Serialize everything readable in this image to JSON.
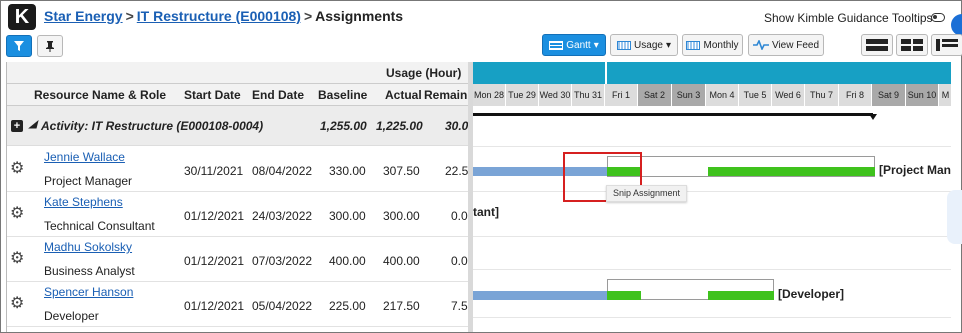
{
  "header": {
    "logo_letter": "K",
    "breadcrumb": [
      {
        "label": "Star Energy"
      },
      {
        "label": "IT Restructure (E000108)"
      },
      {
        "label": "Assignments"
      }
    ],
    "separator": ">",
    "guidance_label": "Show Kimble Guidance Tooltips"
  },
  "toolbar": {
    "gantt_label": "Gantt",
    "usage_label": "Usage",
    "monthly_label": "Monthly",
    "view_feed_label": "View Feed"
  },
  "table": {
    "group_header": "Usage (Hour)",
    "columns": [
      "Resource Name & Role",
      "Start Date",
      "End Date",
      "Baseline",
      "Actual",
      "Remaining"
    ],
    "activity": {
      "label": "Activity: IT Restructure (E000108-0004)",
      "baseline": "1,255.00",
      "actual": "1,225.00",
      "remaining": "30.0"
    },
    "rows": [
      {
        "name": "Jennie Wallace",
        "role": "Project Manager",
        "start": "30/11/2021",
        "end": "08/04/2022",
        "baseline": "330.00",
        "actual": "307.50",
        "remaining": "22.5"
      },
      {
        "name": "Kate Stephens",
        "role": "Technical Consultant",
        "start": "01/12/2021",
        "end": "24/03/2022",
        "baseline": "300.00",
        "actual": "300.00",
        "remaining": "0.0"
      },
      {
        "name": "Madhu Sokolsky",
        "role": "Business Analyst",
        "start": "01/12/2021",
        "end": "07/03/2022",
        "baseline": "400.00",
        "actual": "400.00",
        "remaining": "0.0"
      },
      {
        "name": "Spencer Hanson",
        "role": "Developer",
        "start": "01/12/2021",
        "end": "05/04/2022",
        "baseline": "225.00",
        "actual": "217.50",
        "remaining": "7.5"
      }
    ]
  },
  "gantt": {
    "days": [
      {
        "label": "Mon 28",
        "weekend": false
      },
      {
        "label": "Tue 29",
        "weekend": false
      },
      {
        "label": "Wed 30",
        "weekend": false
      },
      {
        "label": "Thu 31",
        "weekend": false
      },
      {
        "label": "Fri 1",
        "weekend": false
      },
      {
        "label": "Sat 2",
        "weekend": true
      },
      {
        "label": "Sun 3",
        "weekend": true
      },
      {
        "label": "Mon 4",
        "weekend": false
      },
      {
        "label": "Tue 5",
        "weekend": false
      },
      {
        "label": "Wed 6",
        "weekend": false
      },
      {
        "label": "Thu 7",
        "weekend": false
      },
      {
        "label": "Fri 8",
        "weekend": false
      },
      {
        "label": "Sat 9",
        "weekend": true
      },
      {
        "label": "Sun 10",
        "weekend": true
      },
      {
        "label": "M",
        "weekend": false
      }
    ],
    "labels": {
      "row1": "[Project Mana",
      "row2": "tant]",
      "row4": "[Developer]"
    },
    "tooltip": "Snip Assignment",
    "colors": {
      "actual": "#7aa4d6",
      "planned": "#3fc21d",
      "header_band": "#17a0c4"
    }
  }
}
